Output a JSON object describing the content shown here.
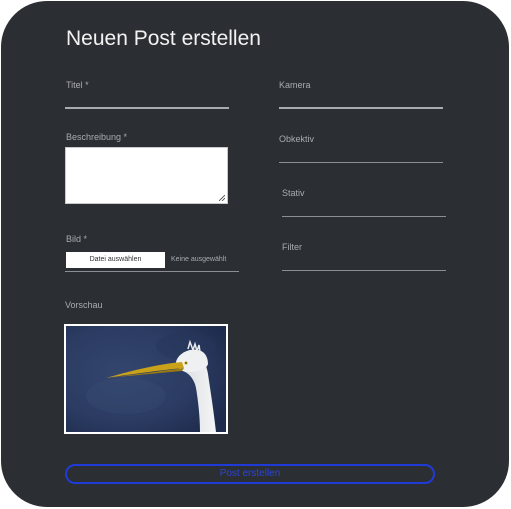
{
  "form": {
    "title": "Neuen Post erstellen",
    "fields": {
      "titel": {
        "label": "Titel *",
        "value": ""
      },
      "beschreibung": {
        "label": "Beschreibung *",
        "value": ""
      },
      "bild": {
        "label": "Bild *",
        "button_label": "Datei auswählen",
        "status": "Keine ausgewählt"
      },
      "kamera": {
        "label": "Kamera",
        "value": ""
      },
      "objektiv": {
        "label": "Obkektiv",
        "value": ""
      },
      "stativ": {
        "label": "Stativ",
        "value": ""
      },
      "filter": {
        "label": "Filter",
        "value": ""
      }
    },
    "preview": {
      "label": "Vorschau"
    },
    "submit_label": "Post erstellen"
  },
  "colors": {
    "panel_background": "#2b2e33",
    "text_primary": "#f2f2f2",
    "text_muted": "#a8abb0",
    "submit_accent": "#1f3ad6"
  }
}
